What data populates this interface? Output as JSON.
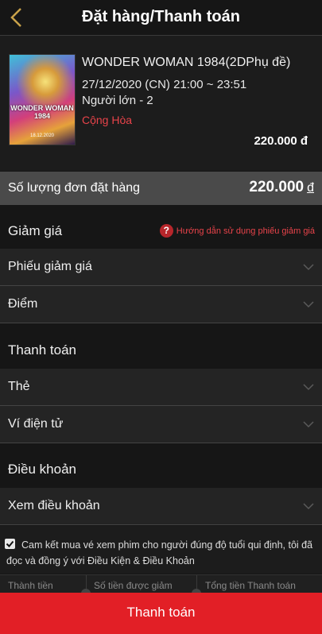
{
  "header": {
    "title": "Đặt hàng/Thanh toán",
    "back_icon": "chevron-left-icon"
  },
  "movie": {
    "poster_title": "WONDER WOMAN 1984",
    "poster_date": "18.12.2020",
    "title": "WONDER WOMAN 1984(2DPhụ đề)",
    "showtime": "27/12/2020 (CN) 21:00 ~ 23:51",
    "ticket": "Người lớn - 2",
    "cinema": "Cộng Hòa",
    "price": "220.000 đ"
  },
  "order_total": {
    "label": "Số lượng đơn đặt hàng",
    "amount": "220.000",
    "currency": "đ"
  },
  "discount": {
    "title": "Giảm giá",
    "help_text": "Hướng dẫn sử dụng phiếu giảm giá",
    "items": [
      "Phiếu giảm giá",
      "Điểm"
    ]
  },
  "payment": {
    "title": "Thanh toán",
    "items": [
      "Thẻ",
      "Ví điện tử"
    ]
  },
  "terms": {
    "title": "Điều khoản",
    "items": [
      "Xem điều khoản"
    ]
  },
  "agreement": {
    "checked": true,
    "text": "Cam kết mua vé xem phim cho người đúng độ tuổi qui định, tôi đã đọc và đồng ý với Điều Kiện & Điều Khoản"
  },
  "summary": {
    "subtotal_label": "Thành tiền",
    "discount_label": "Số tiền được giảm",
    "total_label": "Tổng tiền Thanh toán"
  },
  "pay_button": "Thanh toán",
  "colors": {
    "accent": "#e21f26",
    "cinema_text": "#e8434a",
    "back_icon": "#c9a24a"
  }
}
